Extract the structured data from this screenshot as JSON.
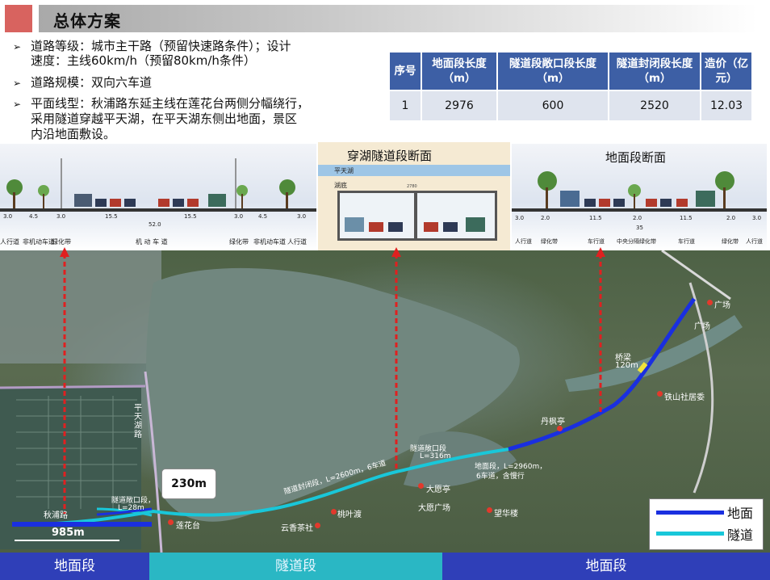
{
  "header": {
    "title": "总体方案"
  },
  "bullets": [
    "道路等级：城市主干路（预留快速路条件）；设计",
    "速度：主线60km/h（预留80km/h条件）",
    "道路规模：双向六车道",
    "平面线型：秋浦路东延主线在莲花台两侧分幅绕行，",
    "采用隧道穿越平天湖，在平天湖东侧出地面，景区",
    "内沿地面敷设。"
  ],
  "table": {
    "headers": [
      "序号",
      "地面段长度（m）",
      "隧道段敞口段长度（m）",
      "隧道封闭段长度（m）",
      "造价（亿元）"
    ],
    "rows": [
      [
        "1",
        "2976",
        "600",
        "2520",
        "12.03"
      ]
    ]
  },
  "sections": {
    "left": {
      "dims": [
        "3.0",
        "4.5",
        "3.0",
        "15.5",
        "15.5",
        "3.0",
        "4.5",
        "3.0"
      ],
      "total": "52.0",
      "labels": [
        "人行道",
        "非机动车道",
        "绿化带",
        "机 动 车 道",
        "绿化带",
        "非机动车道",
        "人行道"
      ]
    },
    "middle": {
      "title": "穿湖隧道段断面",
      "lake": "平天湖",
      "bed": "湖底",
      "width": "2780"
    },
    "right": {
      "title": "地面段断面",
      "dims": [
        "3.0",
        "2.0",
        "11.5",
        "2.0",
        "11.5",
        "2.0",
        "3.0"
      ],
      "total": "35",
      "labels": [
        "人行道",
        "绿化带",
        "车行道",
        "中央分隔绿化带",
        "车行道",
        "绿化带",
        "人行道"
      ]
    }
  },
  "map": {
    "callout": "230m",
    "dim_985": "985m",
    "places": {
      "lianhuatai": "莲花台",
      "taoyedu": "桃叶渡",
      "yunxiang": "云香茶社",
      "dayuanting": "大愿亭",
      "dayuanguangchang": "大愿广场",
      "wanghualou": "望华楼",
      "danfengting": "丹枫亭",
      "tieshan": "铁山社居委",
      "guangchang1": "广场",
      "guangchang2": "广场",
      "pingtianhu_road": "平天湖路",
      "bridge": "桥梁",
      "bridge_len": "120m",
      "open_section": "隧道敞口段",
      "open_len": "L=316m",
      "closed_section": "隧道封闭段，L=2600m，6车道",
      "ground_section": "地面段，L=2960m，",
      "ground_section2": "6车道，含慢行",
      "qiupu": "秋浦路",
      "left_open": "隧道敞口段，",
      "left_open2": "L=28m"
    },
    "legend": {
      "ground": "地面",
      "tunnel": "隧道"
    }
  },
  "bottom_band": [
    "地面段",
    "隧道段",
    "地面段"
  ],
  "colors": {
    "accent": "#d8635f",
    "table_header": "#3d5fa5",
    "ground_line": "#1a2fe0",
    "tunnel_line": "#19c7d9",
    "band_blue": "#2f3fb8",
    "band_teal": "#2ab7c4"
  }
}
